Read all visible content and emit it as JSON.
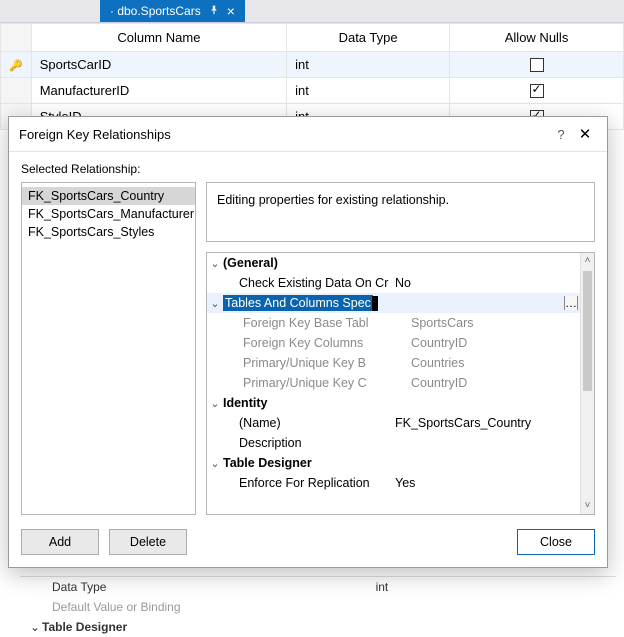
{
  "tab": {
    "title": "· dbo.SportsCars"
  },
  "table": {
    "headers": {
      "name": "Column Name",
      "type": "Data Type",
      "nulls": "Allow Nulls"
    },
    "rows": [
      {
        "name": "SportsCarID",
        "type": "int",
        "nulls": false,
        "pk": true
      },
      {
        "name": "ManufacturerID",
        "type": "int",
        "nulls": true,
        "pk": false
      },
      {
        "name": "StyleID",
        "type": "int",
        "nulls": true,
        "pk": false
      }
    ]
  },
  "bgprops": {
    "rows": [
      {
        "k": "Data Type",
        "v": "int",
        "dim": false
      },
      {
        "k": "Default Value or Binding",
        "v": "",
        "dim": true
      }
    ],
    "group": "Table Designer"
  },
  "dialog": {
    "title": "Foreign Key Relationships",
    "selected_label": "Selected Relationship:",
    "list": [
      "FK_SportsCars_Country",
      "FK_SportsCars_Manufacturer",
      "FK_SportsCars_Styles"
    ],
    "desc": "Editing properties for existing relationship.",
    "props": {
      "general": "(General)",
      "check_existing_k": "Check Existing Data On Cr",
      "check_existing_v": "No",
      "tcs_label": "Tables And Columns Spec",
      "fk_base_k": "Foreign Key Base Tabl",
      "fk_base_v": "SportsCars",
      "fk_cols_k": "Foreign Key Columns",
      "fk_cols_v": "CountryID",
      "pk_base_k": "Primary/Unique Key B",
      "pk_base_v": "Countries",
      "pk_cols_k": "Primary/Unique Key C",
      "pk_cols_v": "CountryID",
      "identity": "Identity",
      "name_k": "(Name)",
      "name_v": "FK_SportsCars_Country",
      "descr_k": "Description",
      "td": "Table Designer",
      "enforce_k": "Enforce For Replication",
      "enforce_v": "Yes"
    },
    "buttons": {
      "add": "Add",
      "delete": "Delete",
      "close": "Close"
    }
  }
}
